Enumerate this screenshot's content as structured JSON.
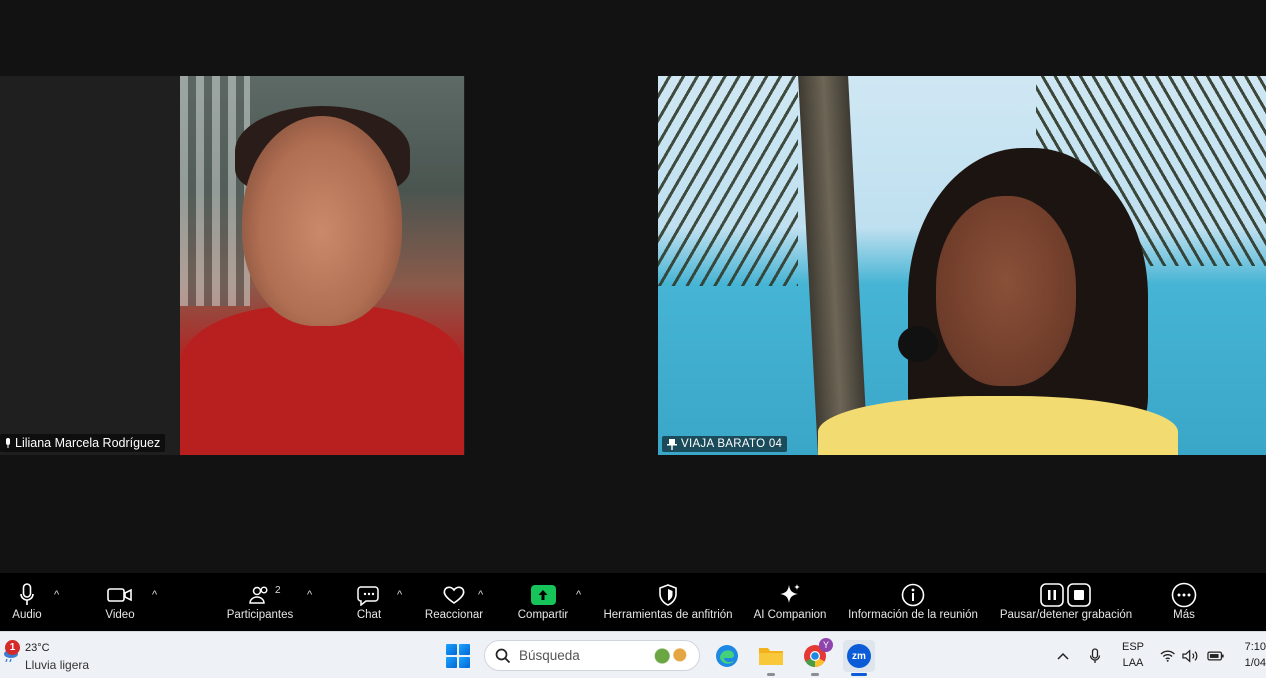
{
  "meeting": {
    "participants": [
      {
        "name": "Liliana Marcela Rodríguez"
      },
      {
        "name": "VIAJA BARATO 04"
      }
    ]
  },
  "toolbar": {
    "audio_label": "Audio",
    "video_label": "Video",
    "participants_label": "Participantes",
    "participants_count": "2",
    "chat_label": "Chat",
    "react_label": "Reaccionar",
    "share_label": "Compartir",
    "host_tools_label": "Herramientas de anfitrión",
    "ai_companion_label": "AI Companion",
    "meeting_info_label": "Información de la reunión",
    "recording_label": "Pausar/detener grabación",
    "more_label": "Más",
    "caret": "^",
    "colors": {
      "share_green": "#17c45a",
      "bar_bg": "#000000"
    }
  },
  "taskbar": {
    "weather": {
      "alert_count": "1",
      "temp": "23°C",
      "condition": "Lluvia ligera"
    },
    "search_placeholder": "Búsqueda",
    "apps": [
      "edge-icon",
      "file-explorer-icon",
      "chrome-icon",
      "zoom-icon"
    ],
    "zoom_app_label": "zm",
    "chrome_badge": "Y",
    "language": {
      "line1": "ESP",
      "line2": "LAA"
    },
    "clock": {
      "time": "7:10",
      "date": "1/04"
    }
  }
}
